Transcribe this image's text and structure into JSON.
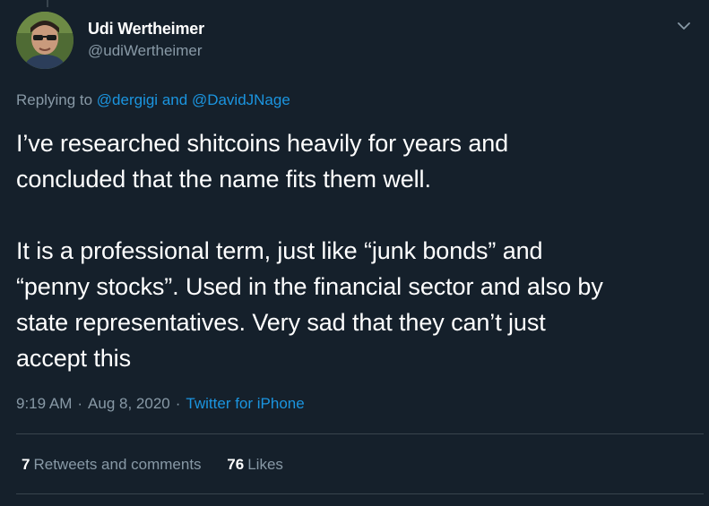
{
  "colors": {
    "background": "#15202b",
    "text_primary": "#ffffff",
    "text_secondary": "#8899a6",
    "link": "#1b95e0",
    "divider": "#38444d"
  },
  "tweet": {
    "author": {
      "display_name": "Udi Wertheimer",
      "handle": "@udiWertheimer",
      "avatar_icon": "avatar-photo"
    },
    "menu_icon": "chevron-down-icon",
    "reply_to": {
      "prefix": "Replying to",
      "user1": "@dergigi",
      "conjunction": "and",
      "user2": "@DavidJNage"
    },
    "text": {
      "paragraph1": "I’ve researched shitcoins heavily for years and\nconcluded that the name fits them well.",
      "paragraph2": "It is a professional term, just like “junk bonds” and\n“penny stocks”. Used in the financial sector and also by\nstate representatives. Very sad that they can’t just\naccept this"
    },
    "time": "9:19 AM",
    "separator": "·",
    "date": "Aug 8, 2020",
    "source": "Twitter for iPhone",
    "stats": {
      "retweets_count": "7",
      "retweets_label": "Retweets and comments",
      "likes_count": "76",
      "likes_label": "Likes"
    }
  }
}
